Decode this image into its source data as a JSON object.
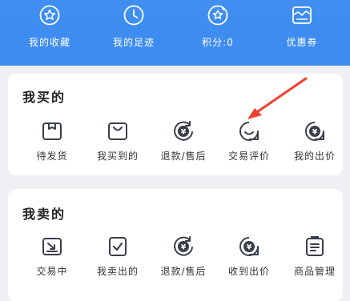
{
  "header": {
    "items": [
      {
        "label": "我的收藏",
        "icon": "star-icon"
      },
      {
        "label": "我的足迹",
        "icon": "clock-icon"
      },
      {
        "label": "积分:0",
        "icon": "points-icon"
      },
      {
        "label": "优惠券",
        "icon": "coupon-icon"
      }
    ]
  },
  "buy": {
    "title": "我买的",
    "items": [
      {
        "label": "待发货",
        "icon": "package-icon"
      },
      {
        "label": "我买到的",
        "icon": "shopping-bag-icon"
      },
      {
        "label": "退款/售后",
        "icon": "refund-icon"
      },
      {
        "label": "交易评价",
        "icon": "chat-review-icon"
      },
      {
        "label": "我的出价",
        "icon": "bid-icon"
      }
    ]
  },
  "sell": {
    "title": "我卖的",
    "items": [
      {
        "label": "交易中",
        "icon": "trading-icon"
      },
      {
        "label": "我卖出的",
        "icon": "sold-icon"
      },
      {
        "label": "退款/售后",
        "icon": "refund-icon"
      },
      {
        "label": "收到出价",
        "icon": "received-bid-icon"
      },
      {
        "label": "商品管理",
        "icon": "product-manage-icon"
      }
    ]
  },
  "colors": {
    "header": "#3f8ef0",
    "icon_stroke": "#3a3f4b",
    "arrow": "#f0402e"
  }
}
